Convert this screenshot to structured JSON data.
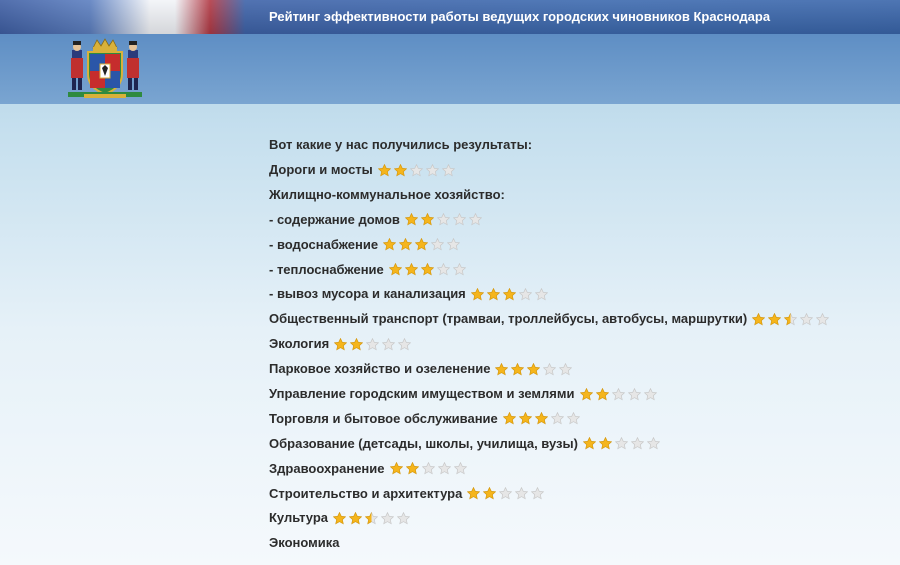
{
  "header": {
    "title": "Рейтинг эффективности работы ведущих городских чиновников Краснодара"
  },
  "colors": {
    "star_full": "#f5b51c",
    "star_empty": "#e6e6e6",
    "star_outline": "#c8c8c8",
    "text": "#2c2c2c"
  },
  "icons": {
    "emblem": "krasnodar-coat-of-arms-icon",
    "rating": "star-icon"
  },
  "content": {
    "intro": "Вот какие у нас получились результаты:",
    "rows": [
      {
        "label": "Дороги и мосты",
        "rating": 2,
        "max": 5
      },
      {
        "label": "Жилищно-коммунальное хозяйство:"
      },
      {
        "label": "- содержание домов",
        "rating": 2,
        "max": 5
      },
      {
        "label": "- водоснабжение",
        "rating": 3,
        "max": 5
      },
      {
        "label": "- теплоснабжение",
        "rating": 3,
        "max": 5
      },
      {
        "label": "- вывоз мусора и канализация",
        "rating": 3,
        "max": 5
      },
      {
        "label": "Общественный транспорт (трамваи, троллейбусы, автобусы, маршрутки)",
        "rating": 2.5,
        "max": 5
      },
      {
        "label": "Экология",
        "rating": 2,
        "max": 5
      },
      {
        "label": "Парковое хозяйство и озеленение",
        "rating": 3,
        "max": 5
      },
      {
        "label": "Управление городским имуществом и землями",
        "rating": 2,
        "max": 5
      },
      {
        "label": "Торговля и бытовое обслуживание",
        "rating": 3,
        "max": 5
      },
      {
        "label": "Образование (детсады, школы, училища, вузы)",
        "rating": 2,
        "max": 5
      },
      {
        "label": "Здравоохранение",
        "rating": 2,
        "max": 5
      },
      {
        "label": "Строительство и архитектура",
        "rating": 2,
        "max": 5
      },
      {
        "label": "Культура",
        "rating": 2.5,
        "max": 5
      },
      {
        "label": "Экономика"
      }
    ]
  }
}
